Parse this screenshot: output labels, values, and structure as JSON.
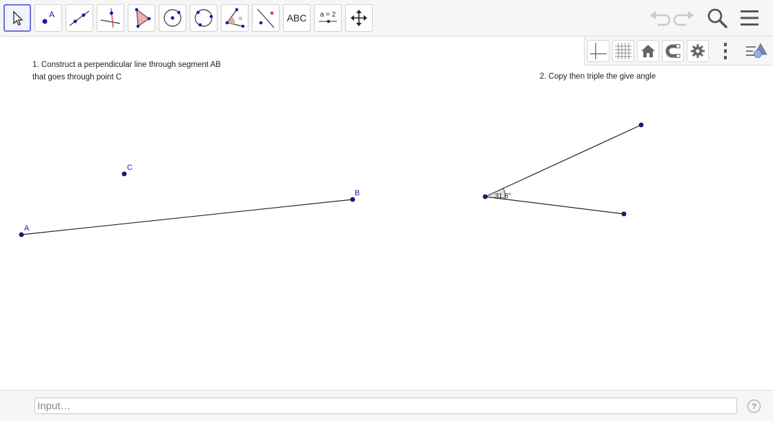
{
  "toolbar": {
    "tools": [
      {
        "name": "move",
        "icon": "cursor-arrow-icon"
      },
      {
        "name": "point",
        "icon": "point-icon",
        "label": "A"
      },
      {
        "name": "line",
        "icon": "line-through-two-points-icon"
      },
      {
        "name": "perpendicular-line",
        "icon": "perpendicular-line-icon"
      },
      {
        "name": "polygon",
        "icon": "polygon-icon"
      },
      {
        "name": "circle-center-point",
        "icon": "circle-center-point-icon"
      },
      {
        "name": "circle-three-points",
        "icon": "circle-three-points-icon"
      },
      {
        "name": "angle",
        "icon": "angle-icon",
        "label": "α"
      },
      {
        "name": "reflect",
        "icon": "reflect-about-line-icon"
      },
      {
        "name": "text",
        "icon": "text-icon",
        "label": "ABC"
      },
      {
        "name": "slider",
        "icon": "slider-icon",
        "label": "a = 2"
      },
      {
        "name": "move-graphics-view",
        "icon": "move-view-icon"
      }
    ],
    "selected_tool": "move",
    "right": [
      "undo-icon",
      "redo-icon",
      "search-icon",
      "menu-icon"
    ]
  },
  "stylebar": {
    "buttons": [
      "axes-toggle-icon",
      "grid-toggle-icon",
      "home-icon",
      "magnet-icon",
      "gear-icon",
      "more-vertical-icon",
      "style-toggle-icon"
    ]
  },
  "canvas": {
    "task1_line1": "1. Construct a perpendicular line through segment AB",
    "task1_line2": "that goes through point C",
    "task2": "2. Copy then triple the give angle",
    "points": {
      "A": "A",
      "B": "B",
      "C": "C"
    },
    "angle_label": "31.8°",
    "point_color": "#1a1aa0",
    "label_color": "#1515c8",
    "angle_fill": "#b4a0a0"
  },
  "input": {
    "placeholder": "Input…"
  },
  "help_label": "?"
}
